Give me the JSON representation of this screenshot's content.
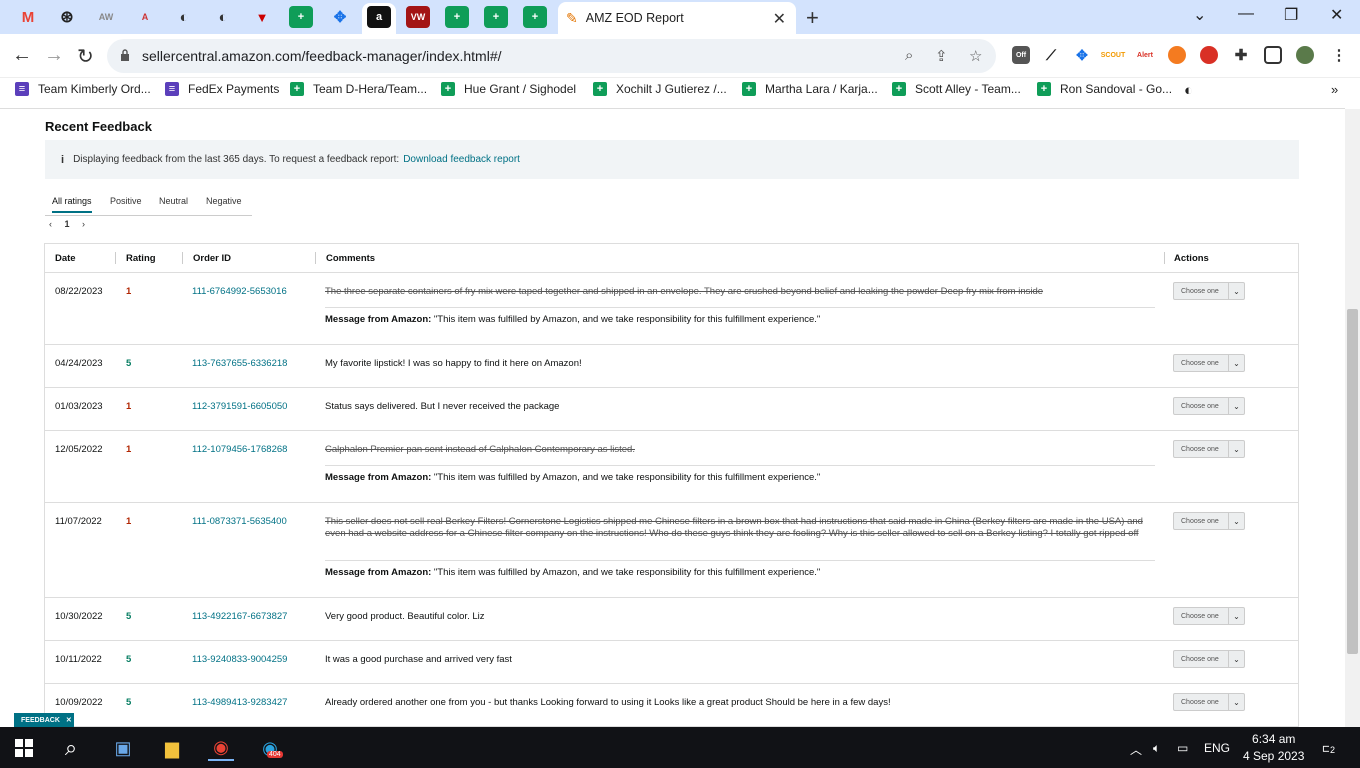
{
  "browser": {
    "tab_title": "AMZ EOD Report",
    "url": "sellercentral.amazon.com/feedback-manager/index.html#/",
    "bookmarks": [
      {
        "label": "Team Kimberly Ord...",
        "color": "#5b3fbb"
      },
      {
        "label": "FedEx Payments",
        "color": "#5b3fbb"
      },
      {
        "label": "Team D-Hera/Team...",
        "color": "#0f9d58"
      },
      {
        "label": "Hue Grant / Sighodel",
        "color": "#0f9d58"
      },
      {
        "label": "Xochilt J Gutierez /...",
        "color": "#0f9d58"
      },
      {
        "label": "Martha Lara / Karja...",
        "color": "#0f9d58"
      },
      {
        "label": "Scott Alley - Team...",
        "color": "#0f9d58"
      },
      {
        "label": "Ron Sandoval - Go...",
        "color": "#0f9d58"
      }
    ]
  },
  "section": {
    "title": "Recent Feedback",
    "info_icon": "i",
    "info_text": "Displaying feedback from the last 365 days. To request a feedback report:",
    "info_link": "Download feedback report"
  },
  "filter_tabs": [
    "All ratings",
    "Positive",
    "Neutral",
    "Negative"
  ],
  "pager": {
    "prev": "‹",
    "page": "1",
    "next": "›"
  },
  "table": {
    "headers": [
      "Date",
      "Rating",
      "Order ID",
      "Comments",
      "Actions"
    ],
    "select_label": "Choose one",
    "message_prefix": "Message from Amazon:",
    "message_text": "\"This item was fulfilled by Amazon, and we take responsibility for this fulfillment experience.\"",
    "rows": [
      {
        "date": "08/22/2023",
        "rating": "1",
        "order": "111-6764992-5653016",
        "comment": "The three separate containers of fry mix were taped together and shipped in an envelope. They are crushed beyond belief and leaking the powder Deep fry mix from inside"
      },
      {
        "date": "04/24/2023",
        "rating": "5",
        "order": "113-7637655-6336218",
        "comment": "My favorite lipstick! I was so happy to find it here on Amazon!"
      },
      {
        "date": "01/03/2023",
        "rating": "1",
        "order": "112-3791591-6605050",
        "comment": "Status says delivered. But I never received the package"
      },
      {
        "date": "12/05/2022",
        "rating": "1",
        "order": "112-1079456-1768268",
        "comment": "Calphalon Premier pan sent instead of Calphalon Contemporary as listed."
      },
      {
        "date": "11/07/2022",
        "rating": "1",
        "order": "111-0873371-5635400",
        "comment": "This seller does not sell real Berkey Filters! Cornerstone Logistics shipped me Chinese filters in a brown box that had instructions that said made in China (Berkey filters are made in the USA) and even had a website address for a Chinese filter company on the instructions! Who do these guys think they are fooling? Why is this seller allowed to sell on a Berkey listing? I totally got ripped off"
      },
      {
        "date": "10/30/2022",
        "rating": "5",
        "order": "113-4922167-6673827",
        "comment": "Very good product. Beautiful color. Liz"
      },
      {
        "date": "10/11/2022",
        "rating": "5",
        "order": "113-9240833-9004259",
        "comment": "It was a good purchase and arrived very fast"
      },
      {
        "date": "10/09/2022",
        "rating": "5",
        "order": "113-4989413-9283427",
        "comment": "Already ordered another one from you - but thanks Looking forward to using it Looks like a great product Should be here in a few days!"
      }
    ]
  },
  "feedback_widget": {
    "label": "FEEDBACK",
    "close": "✕"
  },
  "taskbar": {
    "language": "ENG",
    "time": "6:34 am",
    "date": "4 Sep 2023",
    "notifications": "2",
    "telegram_badge": "404"
  }
}
